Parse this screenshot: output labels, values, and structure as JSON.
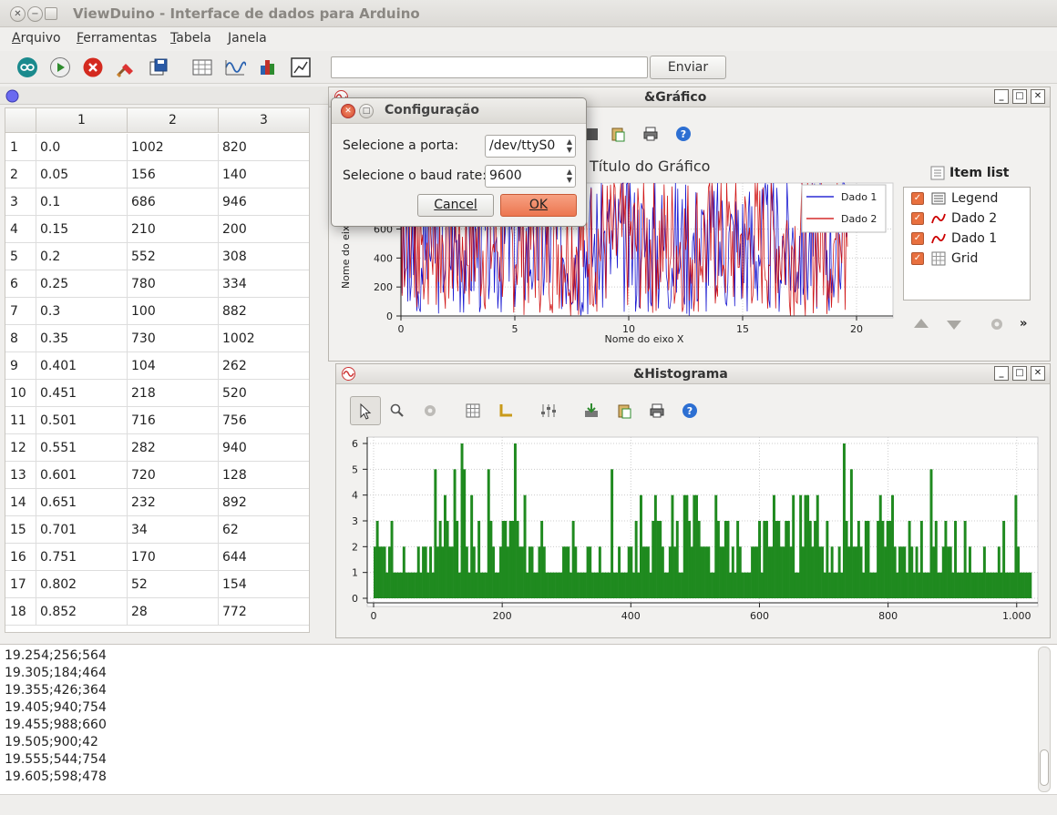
{
  "window": {
    "title": "ViewDuino - Interface de dados para Arduino"
  },
  "menu": [
    {
      "label": "Arquivo",
      "key": "A",
      "rest": "rquivo"
    },
    {
      "label": "Ferramentas",
      "key": "F",
      "rest": "erramentas"
    },
    {
      "label": "Tabela",
      "key": "T",
      "rest": "abela"
    },
    {
      "label": "Janela",
      "key": "J",
      "rest": "anela"
    }
  ],
  "toolbar": {
    "icons": [
      "arduino-icon",
      "play-icon",
      "stop-icon",
      "clear-icon",
      "save-icon",
      "table-icon",
      "plot-icon",
      "histogram-icon",
      "chart-window-icon"
    ],
    "send_value": "",
    "send_label": "Enviar"
  },
  "table": {
    "columns": [
      "1",
      "2",
      "3"
    ],
    "rows": [
      [
        "1",
        "0.0",
        "1002",
        "820"
      ],
      [
        "2",
        "0.05",
        "156",
        "140"
      ],
      [
        "3",
        "0.1",
        "686",
        "946"
      ],
      [
        "4",
        "0.15",
        "210",
        "200"
      ],
      [
        "5",
        "0.2",
        "552",
        "308"
      ],
      [
        "6",
        "0.25",
        "780",
        "334"
      ],
      [
        "7",
        "0.3",
        "100",
        "882"
      ],
      [
        "8",
        "0.35",
        "730",
        "1002"
      ],
      [
        "9",
        "0.401",
        "104",
        "262"
      ],
      [
        "10",
        "0.451",
        "218",
        "520"
      ],
      [
        "11",
        "0.501",
        "716",
        "756"
      ],
      [
        "12",
        "0.551",
        "282",
        "940"
      ],
      [
        "13",
        "0.601",
        "720",
        "128"
      ],
      [
        "14",
        "0.651",
        "232",
        "892"
      ],
      [
        "15",
        "0.701",
        "34",
        "62"
      ],
      [
        "16",
        "0.751",
        "170",
        "644"
      ],
      [
        "17",
        "0.802",
        "52",
        "154"
      ],
      [
        "18",
        "0.852",
        "28",
        "772"
      ]
    ]
  },
  "graph": {
    "title": "&Gráfico",
    "plot_title": "Título do Gráfico",
    "ylabel": "Nome do eixo Y",
    "xlabel": "Nome do eixo X",
    "item_list_title": "Item list",
    "items": [
      {
        "label": "Legend",
        "checked": true
      },
      {
        "label": "Dado 2",
        "checked": true
      },
      {
        "label": "Dado 1",
        "checked": true
      },
      {
        "label": "Grid",
        "checked": true
      }
    ],
    "colors": {
      "dado1": "#0000cc",
      "dado2": "#cc0000"
    }
  },
  "histogram": {
    "title": "&Histograma",
    "color": "#1f8a1f"
  },
  "dialog": {
    "title": "Configuração",
    "port_label": "Selecione a porta:",
    "port_value": "/dev/ttyS0",
    "baud_label": "Selecione o baud rate:",
    "baud_value": "9600",
    "cancel_label": "Cancel",
    "ok_label": "OK"
  },
  "log": {
    "lines": [
      "19.254;256;564",
      "19.305;184;464",
      "19.355;426;364",
      "19.405;940;754",
      "19.455;988;660",
      "19.505;900;42",
      "19.555;544;754",
      "19.605;598;478"
    ]
  },
  "chart_data": [
    {
      "type": "line",
      "title": "Título do Gráfico",
      "xlabel": "Nome do eixo X",
      "ylabel": "Nome do eixo Y",
      "xlim": [
        0,
        20
      ],
      "ylim": [
        0,
        1000
      ],
      "x_ticks": [
        "0",
        "5",
        "10",
        "15",
        "20"
      ],
      "y_ticks": [
        "0",
        "200",
        "400",
        "600"
      ],
      "legend_position": "top-right",
      "grid": true,
      "series": [
        {
          "name": "Dado 1",
          "x": [
            0.0,
            0.05,
            0.1,
            0.15,
            0.2,
            0.25,
            0.3,
            0.35,
            0.401,
            0.451,
            0.501,
            0.551,
            0.601,
            0.651,
            0.701,
            0.751,
            0.802,
            0.852,
            19.254,
            19.305,
            19.355,
            19.405,
            19.455,
            19.505,
            19.555,
            19.605
          ],
          "values": [
            1002,
            156,
            686,
            210,
            552,
            780,
            100,
            730,
            104,
            218,
            716,
            282,
            720,
            232,
            34,
            170,
            52,
            28,
            256,
            184,
            426,
            940,
            988,
            900,
            544,
            598
          ]
        },
        {
          "name": "Dado 2",
          "x": [
            0.0,
            0.05,
            0.1,
            0.15,
            0.2,
            0.25,
            0.3,
            0.35,
            0.401,
            0.451,
            0.501,
            0.551,
            0.601,
            0.651,
            0.701,
            0.751,
            0.802,
            0.852,
            19.254,
            19.305,
            19.355,
            19.405,
            19.455,
            19.505,
            19.555,
            19.605
          ],
          "values": [
            820,
            140,
            946,
            200,
            308,
            334,
            882,
            1002,
            262,
            520,
            756,
            940,
            128,
            892,
            62,
            644,
            154,
            772,
            564,
            464,
            364,
            754,
            660,
            42,
            754,
            478
          ]
        }
      ]
    },
    {
      "type": "bar",
      "xlim": [
        0,
        1023
      ],
      "ylim": [
        0,
        6
      ],
      "x_ticks": [
        "0",
        "200",
        "400",
        "600",
        "800",
        "1.000"
      ],
      "y_ticks": [
        "0",
        "1",
        "2",
        "3",
        "4",
        "5",
        "6"
      ],
      "grid": true,
      "bins": [
        2,
        3,
        2,
        2,
        2,
        1,
        2,
        3,
        1,
        1,
        1,
        1,
        2,
        1,
        1,
        1,
        1,
        1,
        2,
        1,
        2,
        2,
        1,
        2,
        1,
        5,
        2,
        3,
        2,
        4,
        3,
        2,
        2,
        5,
        3,
        1,
        6,
        5,
        2,
        1,
        4,
        2,
        1,
        3,
        1,
        1,
        1,
        5,
        3,
        2,
        1,
        1,
        2,
        3,
        3,
        2,
        3,
        3,
        6,
        3,
        2,
        2,
        4,
        1,
        2,
        2,
        1,
        1,
        2,
        3,
        2,
        1,
        1,
        1,
        1,
        1,
        1,
        1,
        2,
        2,
        2,
        1,
        3,
        2,
        1,
        1,
        1,
        1,
        2,
        2,
        1,
        1,
        1,
        2,
        1,
        1,
        1,
        1,
        5,
        1,
        1,
        2,
        1,
        1,
        1,
        2,
        2,
        1,
        3,
        1,
        4,
        2,
        2,
        2,
        1,
        3,
        4,
        3,
        3,
        2,
        1,
        1,
        2,
        4,
        2,
        3,
        1,
        1,
        4,
        4,
        3,
        2,
        4,
        4,
        3,
        2,
        2,
        2,
        2,
        1,
        1,
        4,
        3,
        2,
        2,
        3,
        3,
        1,
        2,
        1,
        3,
        2,
        1,
        1,
        1,
        1,
        2,
        2,
        2,
        3,
        1,
        3,
        3,
        2,
        2,
        4,
        3,
        3,
        2,
        2,
        3,
        3,
        2,
        4,
        1,
        1,
        4,
        2,
        4,
        4,
        3,
        2,
        3,
        4,
        2,
        2,
        1,
        3,
        1,
        2,
        1,
        1,
        2,
        1,
        6,
        3,
        2,
        5,
        2,
        2,
        3,
        2,
        1,
        3,
        3,
        1,
        1,
        1,
        3,
        4,
        3,
        2,
        3,
        3,
        4,
        2,
        1,
        2,
        2,
        2,
        1,
        3,
        2,
        1,
        2,
        1,
        3,
        1,
        1,
        1,
        5,
        2,
        3,
        1,
        1,
        2,
        3,
        2,
        2,
        1,
        3,
        1,
        1,
        1,
        3,
        1,
        2,
        1,
        1,
        1,
        1,
        1,
        2,
        1,
        1,
        1,
        1,
        1,
        2,
        1,
        3,
        1,
        1,
        1,
        1,
        4,
        2,
        1,
        1,
        1,
        1,
        1
      ]
    }
  ]
}
